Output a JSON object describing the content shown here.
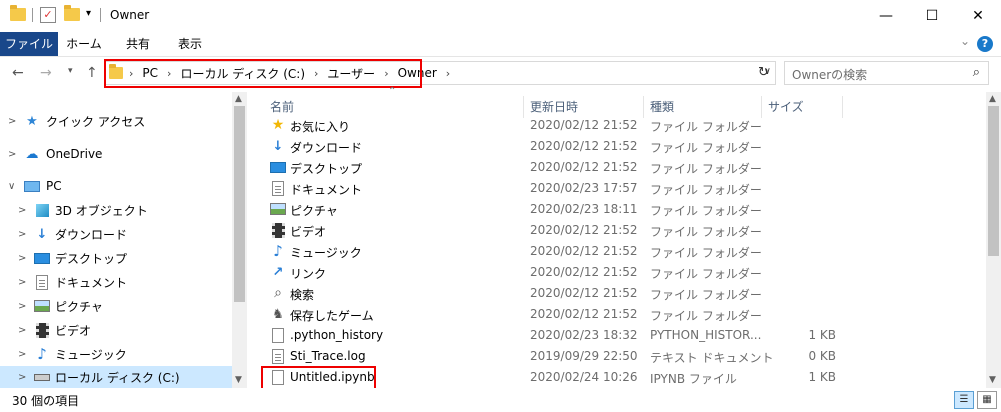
{
  "window": {
    "title": "Owner",
    "controls": {
      "minimize": "—",
      "maximize": "☐",
      "close": "✕"
    }
  },
  "ribbon": {
    "tabs": [
      "ファイル",
      "ホーム",
      "共有",
      "表示"
    ],
    "expand_glyph": "⌄",
    "help_glyph": "?"
  },
  "address": {
    "crumbs": [
      "PC",
      "ローカル ディスク (C:)",
      "ユーザー",
      "Owner"
    ],
    "separator": "›",
    "search_placeholder": "Ownerの検索"
  },
  "nav_pane": {
    "items": [
      {
        "label": "クイック アクセス",
        "icon": "star-icon",
        "level": 0,
        "expander": ">"
      },
      {
        "label": "OneDrive",
        "icon": "cloud-icon",
        "level": 0,
        "expander": ">"
      },
      {
        "label": "PC",
        "icon": "pc-icon",
        "level": 0,
        "expander": "∨"
      },
      {
        "label": "3D オブジェクト",
        "icon": "cube-icon",
        "level": 1,
        "expander": ">"
      },
      {
        "label": "ダウンロード",
        "icon": "download-icon",
        "level": 1,
        "expander": ">"
      },
      {
        "label": "デスクトップ",
        "icon": "desktop-icon",
        "level": 1,
        "expander": ">"
      },
      {
        "label": "ドキュメント",
        "icon": "document-icon",
        "level": 1,
        "expander": ">"
      },
      {
        "label": "ピクチャ",
        "icon": "pictures-icon",
        "level": 1,
        "expander": ">"
      },
      {
        "label": "ビデオ",
        "icon": "video-icon",
        "level": 1,
        "expander": ">"
      },
      {
        "label": "ミュージック",
        "icon": "music-icon",
        "level": 1,
        "expander": ">"
      },
      {
        "label": "ローカル ディスク (C:)",
        "icon": "drive-icon",
        "level": 1,
        "expander": ">",
        "selected": true
      }
    ]
  },
  "columns": {
    "name": "名前",
    "date": "更新日時",
    "type": "種類",
    "size": "サイズ"
  },
  "files": [
    {
      "name": "お気に入り",
      "date": "2020/02/12 21:52",
      "type": "ファイル フォルダー",
      "size": "",
      "icon": "favorites-icon"
    },
    {
      "name": "ダウンロード",
      "date": "2020/02/12 21:52",
      "type": "ファイル フォルダー",
      "size": "",
      "icon": "download-icon"
    },
    {
      "name": "デスクトップ",
      "date": "2020/02/12 21:52",
      "type": "ファイル フォルダー",
      "size": "",
      "icon": "desktop-icon"
    },
    {
      "name": "ドキュメント",
      "date": "2020/02/23 17:57",
      "type": "ファイル フォルダー",
      "size": "",
      "icon": "document-icon"
    },
    {
      "name": "ピクチャ",
      "date": "2020/02/23 18:11",
      "type": "ファイル フォルダー",
      "size": "",
      "icon": "pictures-icon"
    },
    {
      "name": "ビデオ",
      "date": "2020/02/12 21:52",
      "type": "ファイル フォルダー",
      "size": "",
      "icon": "video-icon"
    },
    {
      "name": "ミュージック",
      "date": "2020/02/12 21:52",
      "type": "ファイル フォルダー",
      "size": "",
      "icon": "music-icon"
    },
    {
      "name": "リンク",
      "date": "2020/02/12 21:52",
      "type": "ファイル フォルダー",
      "size": "",
      "icon": "link-icon"
    },
    {
      "name": "検索",
      "date": "2020/02/12 21:52",
      "type": "ファイル フォルダー",
      "size": "",
      "icon": "search-icon"
    },
    {
      "name": "保存したゲーム",
      "date": "2020/02/12 21:52",
      "type": "ファイル フォルダー",
      "size": "",
      "icon": "game-icon"
    },
    {
      "name": ".python_history",
      "date": "2020/02/23 18:32",
      "type": "PYTHON_HISTOR...",
      "size": "1 KB",
      "icon": "blank-file-icon"
    },
    {
      "name": "Sti_Trace.log",
      "date": "2019/09/29 22:50",
      "type": "テキスト ドキュメント",
      "size": "0 KB",
      "icon": "text-file-icon"
    },
    {
      "name": "Untitled.ipynb",
      "date": "2020/02/24 10:26",
      "type": "IPYNB ファイル",
      "size": "1 KB",
      "icon": "blank-file-icon"
    }
  ],
  "status": {
    "item_count": "30 個の項目"
  }
}
